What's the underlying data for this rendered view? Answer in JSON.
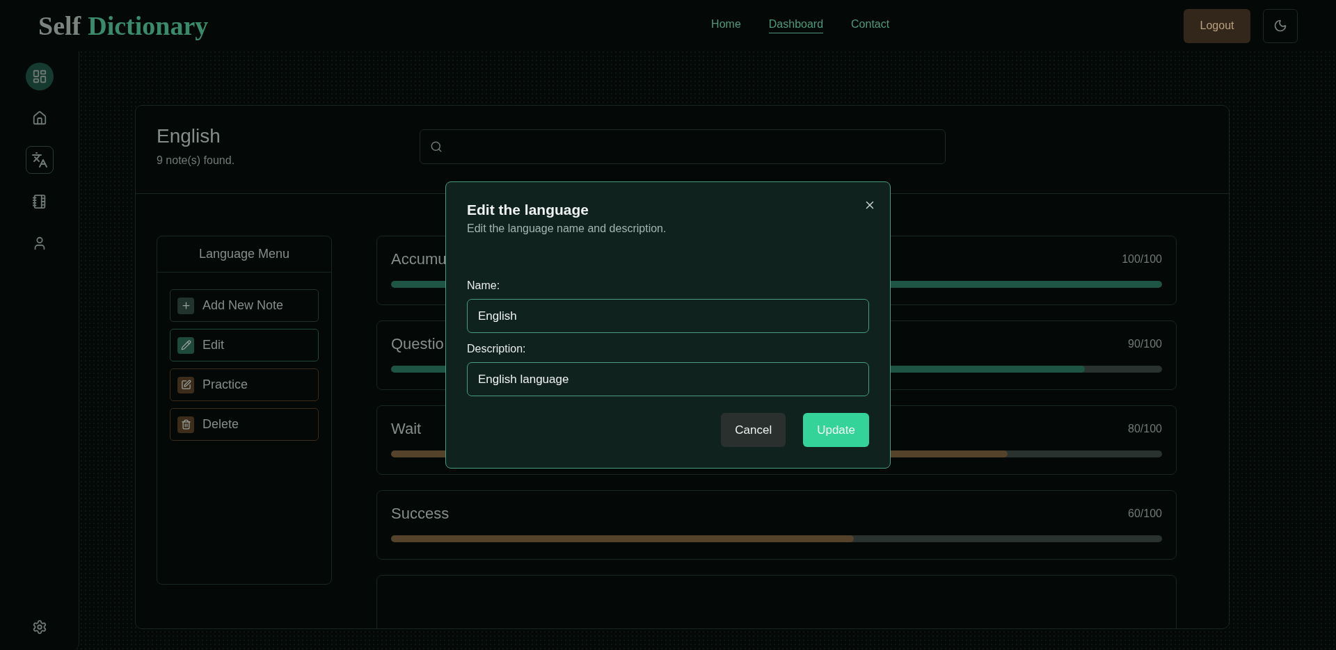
{
  "header": {
    "logo": {
      "first": "Self",
      "second": "Dictionary"
    },
    "nav": [
      {
        "label": "Home",
        "selected": false
      },
      {
        "label": "Dashboard",
        "selected": true
      },
      {
        "label": "Contact",
        "selected": false
      }
    ],
    "logout": "Logout"
  },
  "sidebar": {
    "items": [
      {
        "kind": "dashboard",
        "selected": true,
        "outlined": false
      },
      {
        "kind": "home",
        "selected": false,
        "outlined": false
      },
      {
        "kind": "languages",
        "selected": false,
        "outlined": true
      },
      {
        "kind": "notebook",
        "selected": false,
        "outlined": false
      },
      {
        "kind": "user",
        "selected": false,
        "outlined": false
      }
    ]
  },
  "language": {
    "title": "English",
    "count": "9 note(s) found."
  },
  "menu": {
    "title": "Language Menu",
    "items": [
      {
        "kind": "add",
        "label": "Add New Note",
        "color": "#22332d"
      },
      {
        "kind": "edit",
        "label": "Edit",
        "color": "#1e4a3c"
      },
      {
        "kind": "practice",
        "label": "Practice",
        "color": "#3d2c19"
      },
      {
        "kind": "delete",
        "label": "Delete",
        "color": "#3d2c19"
      }
    ]
  },
  "notes": [
    {
      "title": "Accumu",
      "score": "100/100",
      "level": 1.0,
      "color": "#1d5443"
    },
    {
      "title": "Questio",
      "score": "90/100",
      "level": 0.9,
      "color": "#1d5443"
    },
    {
      "title": "Wait",
      "score": "80/100",
      "level": 0.8,
      "color": "#54422a"
    },
    {
      "title": "Success",
      "score": "60/100",
      "level": 0.6,
      "color": "#54422a"
    }
  ],
  "dialog": {
    "title": "Edit the language",
    "subtitle": "Edit the language name and description.",
    "fields": [
      {
        "label": "Name:",
        "value": "English"
      },
      {
        "label": "Description:",
        "value": "English language"
      }
    ],
    "cancel": "Cancel",
    "submit": "Update"
  }
}
